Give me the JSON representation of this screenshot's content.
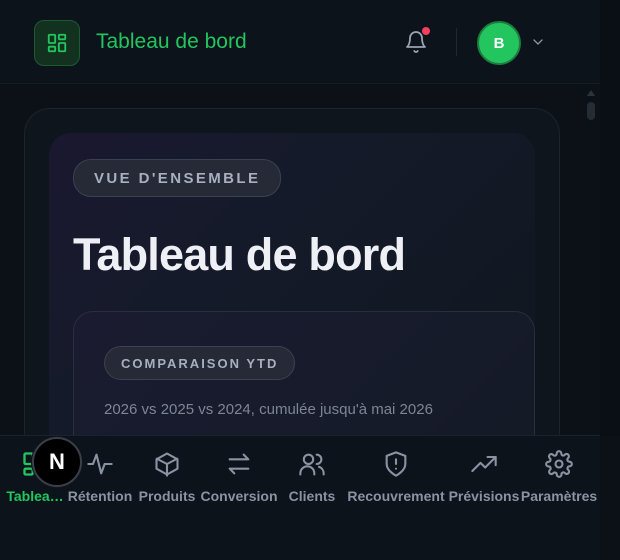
{
  "header": {
    "title": "Tableau de bord",
    "logo_icon": "grid-icon",
    "notification_icon": "bell-icon",
    "has_notification": true,
    "avatar_initial": "B",
    "avatar_menu_icon": "chevron-down-icon"
  },
  "main": {
    "overview_label": "VUE D'ENSEMBLE",
    "page_title": "Tableau de bord",
    "section": {
      "label": "COMPARAISON YTD",
      "subtitle": "2026 vs 2025 vs 2024, cumulée jusqu'à mai 2026"
    }
  },
  "nav": {
    "items": [
      {
        "label": "Tablea…",
        "icon": "grid-icon",
        "active": true
      },
      {
        "label": "Rétention",
        "icon": "activity-icon",
        "active": false
      },
      {
        "label": "Produits",
        "icon": "box-icon",
        "active": false
      },
      {
        "label": "Conversion",
        "icon": "swap-icon",
        "active": false
      },
      {
        "label": "Clients",
        "icon": "users-icon",
        "active": false
      },
      {
        "label": "Recouvrement",
        "icon": "shield-alert-icon",
        "active": false
      },
      {
        "label": "Prévisions",
        "icon": "trending-up-icon",
        "active": false
      },
      {
        "label": "Paramètres",
        "icon": "gear-icon",
        "active": false
      }
    ]
  },
  "dev_badge": {
    "letter": "N"
  },
  "colors": {
    "accent": "#22c55e",
    "notification": "#f43f5e",
    "background": "#0c1118"
  }
}
